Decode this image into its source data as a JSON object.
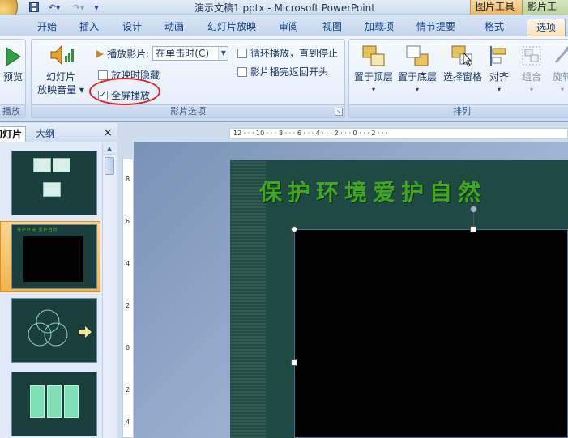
{
  "titlebar": {
    "title": "演示文稿1.pptx - Microsoft PowerPoint",
    "context_tabs": [
      "图片工具",
      "影片工具"
    ]
  },
  "tabs": [
    {
      "label": "开始"
    },
    {
      "label": "插入"
    },
    {
      "label": "设计"
    },
    {
      "label": "动画"
    },
    {
      "label": "幻灯片放映"
    },
    {
      "label": "审阅"
    },
    {
      "label": "视图"
    },
    {
      "label": "加载项"
    },
    {
      "label": "情节提要"
    },
    {
      "label": "格式"
    },
    {
      "label": "选项"
    }
  ],
  "ribbon": {
    "preview": {
      "label": "预览",
      "group": "播放"
    },
    "movie_options": {
      "volume_label_1": "幻灯片",
      "volume_label_2": "放映音量",
      "play_movie_label": "播放影片:",
      "play_movie_value": "在单击时(C)",
      "hide_label": "放映时隐藏",
      "fullscreen_label": "全屏播放",
      "loop_label": "循环播放，直到停止",
      "rewind_label": "影片播完返回开头",
      "group_label": "影片选项",
      "hide_checked": false,
      "fullscreen_checked": true,
      "loop_checked": false,
      "rewind_checked": false
    },
    "arrange": {
      "bring_front": "置于顶层",
      "send_back": "置于底层",
      "selection_pane": "选择窗格",
      "align": "对齐",
      "group": "组合",
      "rotate": "旋转",
      "group_label": "排列"
    }
  },
  "left_panel": {
    "tab_slides": "幻灯片",
    "tab_outline": "大纲",
    "close": "×",
    "thumb2_title": "保护环境 爱护自然"
  },
  "ruler": {
    "horizontal": "12 · · · 10 · · · 8 · · · 6 · · · 4 · · · 2 · · · 0 · · · 2 · · ·",
    "vertical": [
      "8",
      "6",
      "4",
      "2",
      "0",
      "2",
      "4"
    ]
  },
  "slide": {
    "title": "保护环境爱护自然",
    "bg_color": "#1f4a43",
    "title_color": "#3fa61e"
  },
  "colors": {
    "annotation_red": "#e5231e",
    "ribbon_text": "#1d3a68"
  }
}
